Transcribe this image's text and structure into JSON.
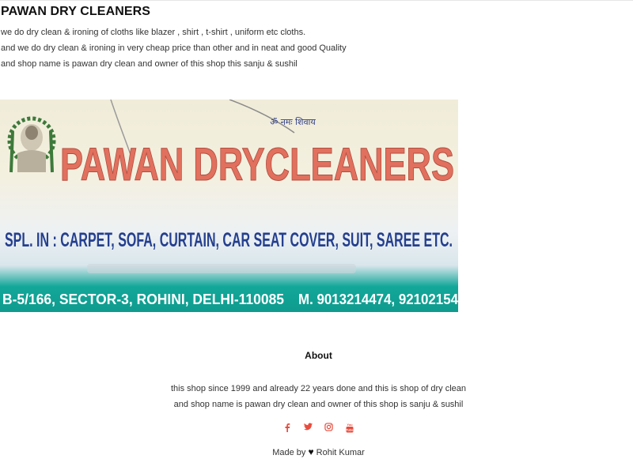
{
  "header": {
    "title": "PAWAN DRY CLEANERS",
    "lines": [
      "we do dry clean & ironing of cloths like blazer , shirt , t-shirt , uniform etc cloths.",
      "and we do dry clean & ironing in very cheap price than other and in neat and good Quality",
      "and shop name is pawan dry clean and owner of this shop this sanju & sushil"
    ]
  },
  "banner": {
    "hindi_text": "ॐ नमः शिवाय",
    "shop_name": "PAWAN DRYCLEANERS",
    "specialization": "SPL. IN : CARPET, SOFA, CURTAIN, CAR SEAT COVER, SUIT, SAREE ETC.",
    "address": "B-5/166, SECTOR-3, ROHINI, DELHI-110085",
    "phone": "M. 9013214474, 92102154"
  },
  "about": {
    "heading": "About",
    "lines": [
      "this shop since 1999 and already 22 years done and this is shop of dry clean",
      "and shop name is pawan dry clean and owner of this shop is sanju & sushil"
    ]
  },
  "social": {
    "color": "#e84c3d",
    "icons": [
      "facebook-icon",
      "twitter-icon",
      "instagram-icon",
      "youtube-icon"
    ]
  },
  "footer": {
    "made_by": "Made by",
    "author": "Rohit Kumar"
  }
}
